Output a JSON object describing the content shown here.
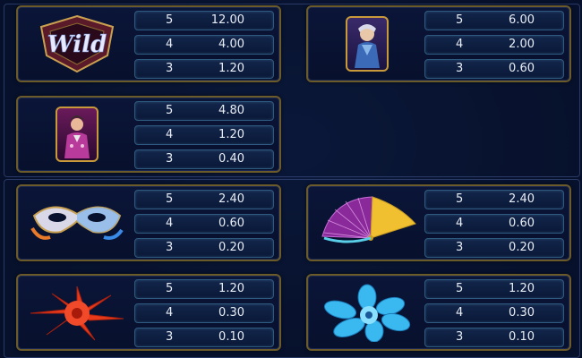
{
  "paytable": {
    "rows": [
      {
        "symbol": "wild-icon",
        "pays": [
          {
            "count": "5",
            "value": "12.00"
          },
          {
            "count": "4",
            "value": "4.00"
          },
          {
            "count": "3",
            "value": "1.20"
          }
        ]
      },
      {
        "symbol": "lady-card-icon",
        "pays": [
          {
            "count": "5",
            "value": "6.00"
          },
          {
            "count": "4",
            "value": "2.00"
          },
          {
            "count": "3",
            "value": "0.60"
          }
        ]
      },
      {
        "symbol": "man-card-icon",
        "pays": [
          {
            "count": "5",
            "value": "4.80"
          },
          {
            "count": "4",
            "value": "1.20"
          },
          {
            "count": "3",
            "value": "0.40"
          }
        ]
      },
      {
        "symbol": "mask-icon",
        "pays": [
          {
            "count": "5",
            "value": "2.40"
          },
          {
            "count": "4",
            "value": "0.60"
          },
          {
            "count": "3",
            "value": "0.20"
          }
        ]
      },
      {
        "symbol": "fan-icon",
        "pays": [
          {
            "count": "5",
            "value": "2.40"
          },
          {
            "count": "4",
            "value": "0.60"
          },
          {
            "count": "3",
            "value": "0.20"
          }
        ]
      },
      {
        "symbol": "red-flower-icon",
        "pays": [
          {
            "count": "5",
            "value": "1.20"
          },
          {
            "count": "4",
            "value": "0.30"
          },
          {
            "count": "3",
            "value": "0.10"
          }
        ]
      },
      {
        "symbol": "blue-flower-icon",
        "pays": [
          {
            "count": "5",
            "value": "1.20"
          },
          {
            "count": "4",
            "value": "0.30"
          },
          {
            "count": "3",
            "value": "0.10"
          }
        ]
      }
    ],
    "wild_label": "Wild"
  }
}
